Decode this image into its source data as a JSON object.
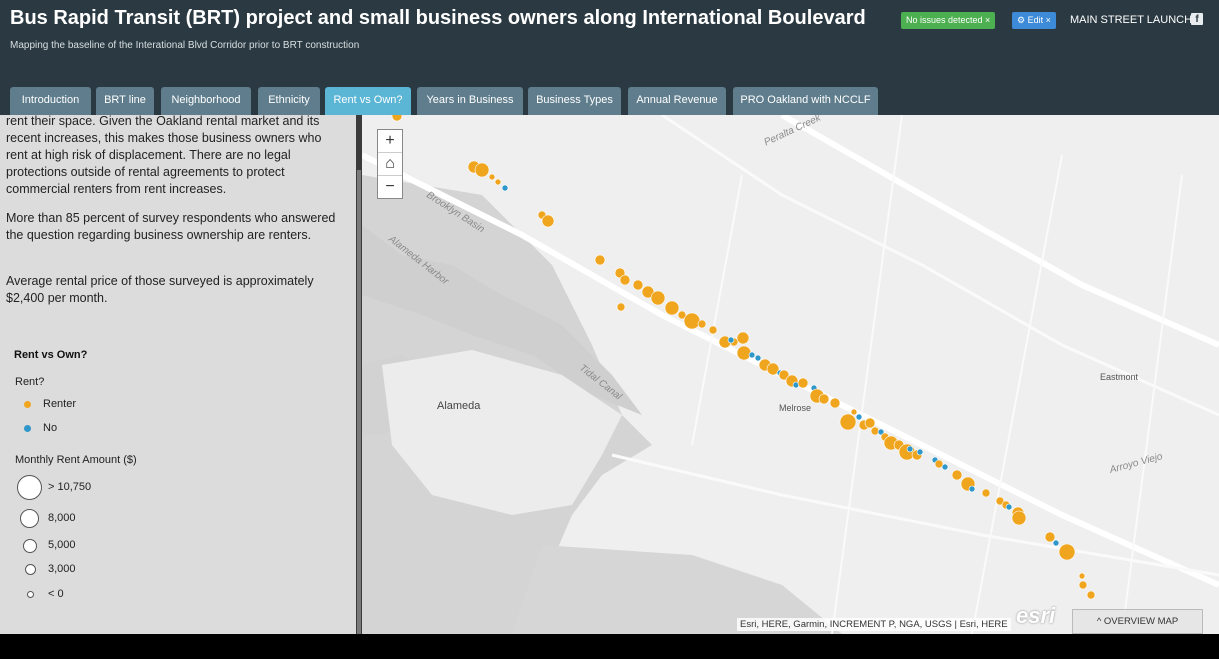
{
  "header": {
    "title": "Bus Rapid Transit (BRT) project and small business owners along International Boulevard",
    "subtitle": "Mapping the baseline of the Interational Blvd Corridor prior to BRT construction",
    "status_badge": "No issues detected ×",
    "edit_button": "⚙ Edit ×",
    "launch_link": "MAIN STREET LAUNCH",
    "facebook_icon": "f"
  },
  "tabs": [
    {
      "label": "Introduction"
    },
    {
      "label": "BRT line"
    },
    {
      "label": "Neighborhood"
    },
    {
      "label": "Ethnicity"
    },
    {
      "label": "Rent vs Own?",
      "active": true
    },
    {
      "label": "Years in Business"
    },
    {
      "label": "Business Types"
    },
    {
      "label": "Annual Revenue"
    },
    {
      "label": "PRO Oakland with NCCLF"
    }
  ],
  "panel": {
    "para1": "rent their space. Given the Oakland rental market and its recent increases, this makes those business owners who rent at high risk of displacement. There are no legal protections outside of rental agreements to protect commercial renters from rent increases.",
    "para2": "More than 85 percent of survey respondents who answered the question regarding business ownership are renters.",
    "para3": "Average rental price of those surveyed is approximately $2,400 per month.",
    "legend": {
      "title": "Rent vs Own?",
      "rent_heading": "Rent?",
      "renter": "Renter",
      "no": "No",
      "amount_heading": "Monthly Rent Amount ($)",
      "sizes": [
        "> 10,750",
        "8,000",
        "5,000",
        "3,000",
        "< 0"
      ]
    }
  },
  "map": {
    "zoom_in": "+",
    "home": "⌂",
    "zoom_out": "−",
    "labels": {
      "alameda": "Alameda",
      "melrose": "Melrose",
      "eastmont": "Eastmont",
      "brooklyn_basin": "Brooklyn Basin",
      "alameda_harbor": "Alameda Harbor",
      "tidal_canal": "Tidal Canal",
      "arroyo_viejo": "Arroyo Viejo",
      "peralta_creek": "Peralta Creek"
    },
    "attribution": "Esri, HERE, Garmin, INCREMENT P, NGA, USGS | Esri, HERE",
    "esri_logo": "esri",
    "overview_button": "^ OVERVIEW MAP"
  },
  "colors": {
    "renter": "#f0a51f",
    "no": "#2f97c9",
    "header_bg": "#2b3a42",
    "tab_bg": "#5f7d8c",
    "tab_active": "#5bb5d5"
  }
}
